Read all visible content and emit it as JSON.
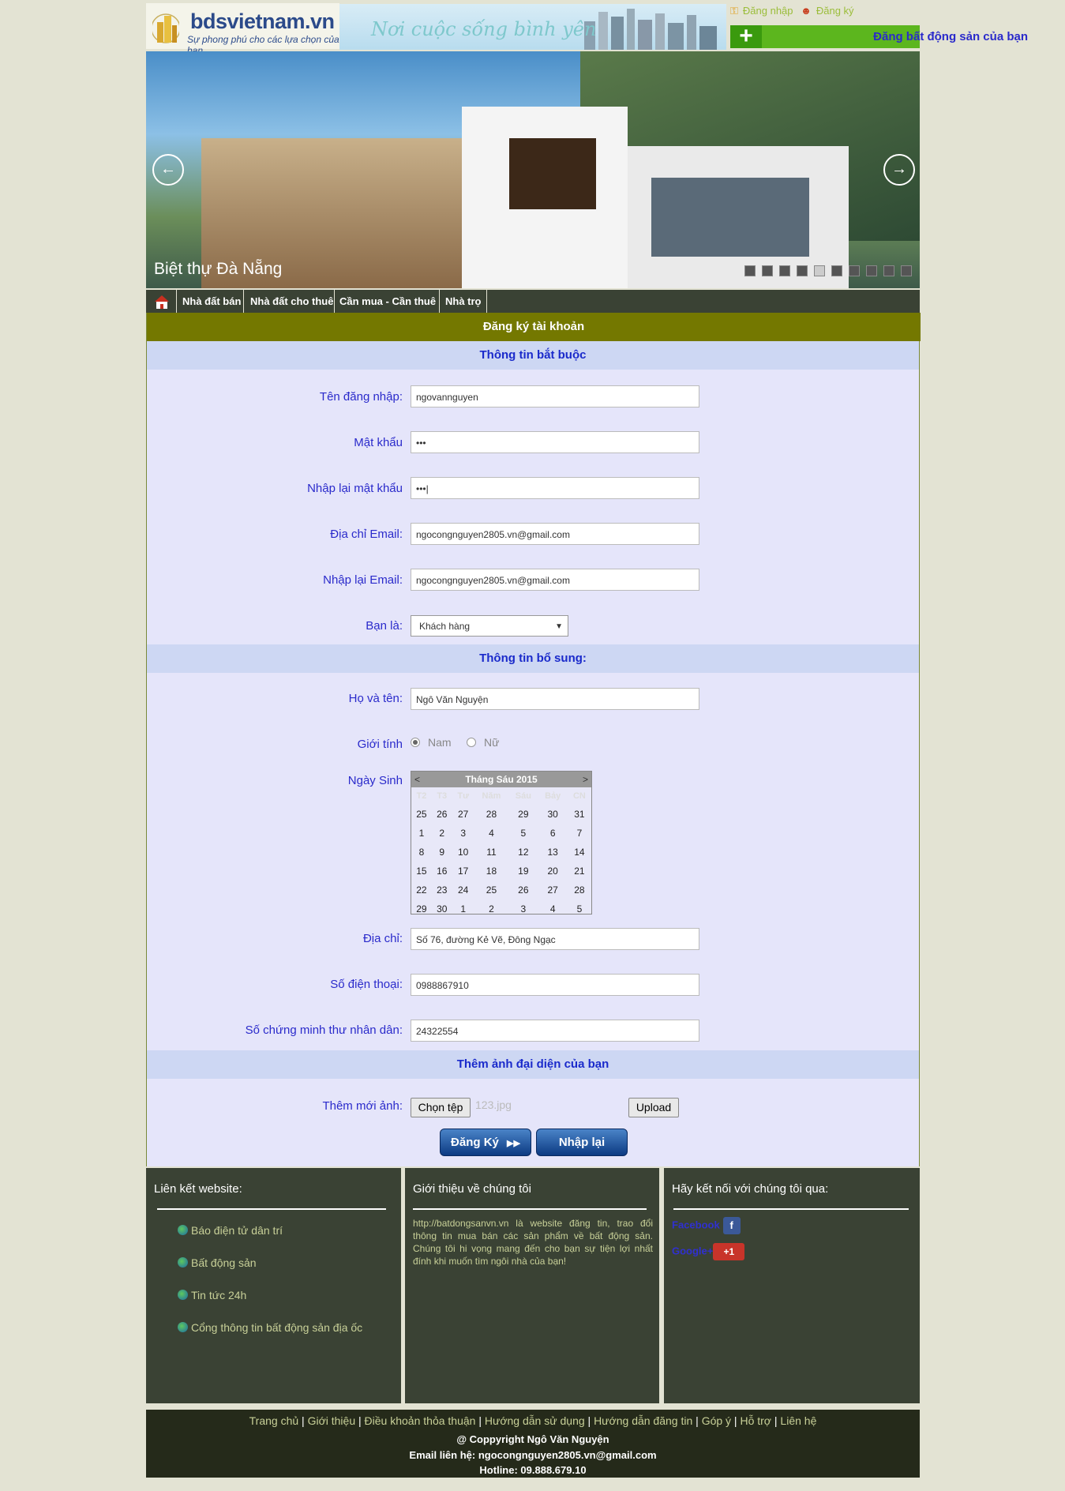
{
  "header": {
    "logo_name": "bdsvietnam.vn",
    "logo_slogan": "Sự phong phú cho các lựa chọn của bạn",
    "banner_script": "Nơi cuộc sống bình yên",
    "login_label": "Đăng nhập",
    "register_label": "Đăng ký",
    "post_button_label": "Đăng bất động sản của bạn"
  },
  "slider": {
    "caption": "Biệt thự Đà Nẵng",
    "prev_icon": "arrow-left-icon",
    "next_icon": "arrow-right-icon",
    "dot_count": 10,
    "active_dot": 4
  },
  "nav": {
    "items": [
      "Nhà đất bán",
      "Nhà đất cho thuê",
      "Cần mua - Cần thuê",
      "Nhà trọ"
    ]
  },
  "form": {
    "title": "Đăng ký tài khoản",
    "section_required": "Thông tin bắt buộc",
    "username_label": "Tên đăng nhập:",
    "username_value": "ngovannguyen",
    "password_label": "Mật khẩu",
    "password_value": "•••",
    "password2_label": "Nhập lại mật khẩu",
    "password2_value": "•••|",
    "email_label": "Địa chỉ Email:",
    "email_value": "ngocongnguyen2805.vn@gmail.com",
    "email2_label": "Nhập lại Email:",
    "email2_value": "ngocongnguyen2805.vn@gmail.com",
    "role_label": "Bạn là:",
    "role_value": "Khách hàng",
    "section_extra": "Thông tin bổ sung:",
    "fullname_label": "Họ và tên:",
    "fullname_value": "Ngô Văn Nguyện",
    "gender_label": "Giới tính",
    "gender_male": "Nam",
    "gender_female": "Nữ",
    "birthday_label": "Ngày Sinh",
    "address_label": "Địa chỉ:",
    "address_value": "Số 76, đường Kẻ Vẽ, Đông Ngạc",
    "phone_label": "Số điện thoại:",
    "phone_value": "0988867910",
    "id_label": "Số chứng minh thư nhân dân:",
    "id_value": "24322554",
    "section_avatar": "Thêm ảnh đại diện của bạn",
    "avatar_label": "Thêm mới ảnh:",
    "choose_file_label": "Chọn tệp",
    "file_name": "123.jpg",
    "upload_label": "Upload",
    "submit_label": "Đăng Ký",
    "reset_label": "Nhập lại"
  },
  "calendar": {
    "title": "Tháng Sáu 2015",
    "prev": "<",
    "next": ">",
    "weekdays": [
      "T2",
      "T3",
      "Tư",
      "Năm",
      "Sáu",
      "Bảy",
      "CN"
    ],
    "weeks": [
      [
        "25",
        "26",
        "27",
        "28",
        "29",
        "30",
        "31"
      ],
      [
        "1",
        "2",
        "3",
        "4",
        "5",
        "6",
        "7"
      ],
      [
        "8",
        "9",
        "10",
        "11",
        "12",
        "13",
        "14"
      ],
      [
        "15",
        "16",
        "17",
        "18",
        "19",
        "20",
        "21"
      ],
      [
        "22",
        "23",
        "24",
        "25",
        "26",
        "27",
        "28"
      ],
      [
        "29",
        "30",
        "1",
        "2",
        "3",
        "4",
        "5"
      ]
    ]
  },
  "footer": {
    "links_title": "Liên kết website:",
    "links": [
      "Báo điện tử dân trí",
      "Bất động sản",
      "Tin tức 24h",
      "Cổng thông tin bất động sản địa ốc"
    ],
    "intro_title": "Giới thiệu về chúng tôi",
    "intro_text": "http://batdongsanvn.vn là website đăng tin, trao đổi thông tin mua bán các sản phẩm về bất động sản. Chúng tôi hi vọng mang đến cho bạn sự tiện lợi nhất đính khi muốn tìm ngôi nhà của bạn!",
    "social_title": "Hãy kết nối với chúng tôi qua:",
    "facebook_label": "Facebook",
    "google_label": "Google+",
    "google_badge": "+1",
    "menu": [
      "Trang chủ",
      "Giới thiệu",
      "Điều khoản thỏa thuận",
      "Hướng dẫn sử dụng",
      "Hướng dẫn đăng tin",
      "Góp ý",
      "Hỗ trợ",
      "Liên hệ"
    ],
    "copyright": "@ Coppyright Ngô Văn Nguyện",
    "email_line": "Email liên hệ: ngocongnguyen2805.vn@gmail.com",
    "hotline": "Hotline: 09.888.679.10"
  }
}
